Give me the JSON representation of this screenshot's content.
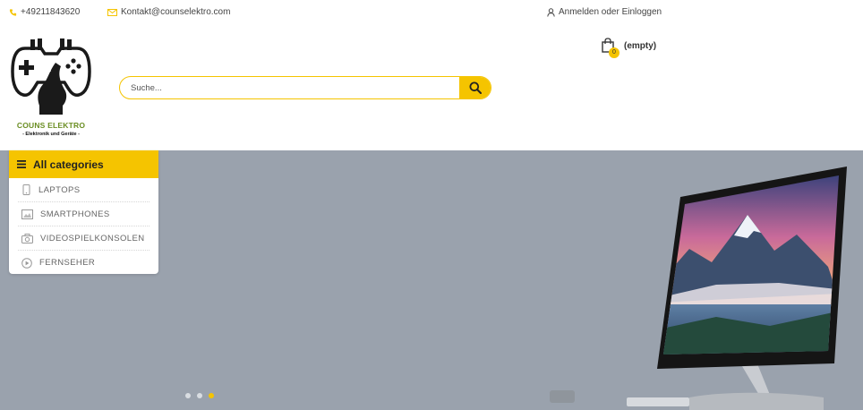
{
  "topbar": {
    "phone": "+49211843620",
    "email": "Kontakt@counselektro.com",
    "login": "Anmelden oder Einloggen"
  },
  "logo": {
    "brand": "COUNS ELEKTRO",
    "tagline": "- Elektronik und Geräte -"
  },
  "search": {
    "placeholder": "Suche..."
  },
  "cart": {
    "count": "0",
    "label": "(empty)"
  },
  "categories": {
    "title": "All categories",
    "items": [
      {
        "label": "LAPTOPS",
        "icon": "tablet-icon"
      },
      {
        "label": "SMARTPHONES",
        "icon": "picture-icon"
      },
      {
        "label": "VIDEOSPIELKONSOLEN",
        "icon": "camera-icon"
      },
      {
        "label": "FERNSEHER",
        "icon": "play-circle-icon"
      }
    ]
  },
  "slider": {
    "dots": 3,
    "active_dot": 3
  },
  "colors": {
    "accent": "#f5c400",
    "hero_bg": "#9aa2ad",
    "brand_green": "#6b8e23"
  }
}
